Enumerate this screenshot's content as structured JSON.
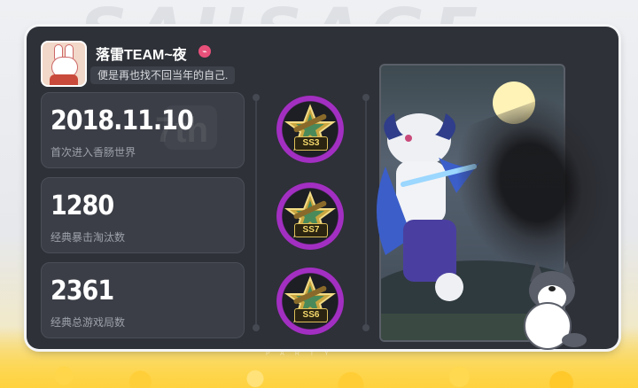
{
  "colors": {
    "panel_bg": "#2e3138",
    "card_bg": "#3b3e46",
    "badge_ring": "#a32fc2",
    "badge_gold": "#e0c05a",
    "accent_coin": "#ffd23f"
  },
  "profile": {
    "name": "落雷TEAM~夜",
    "signature": "便是再也找不回当年的自己.",
    "name_badge_icon": "ticket-icon"
  },
  "stats": [
    {
      "value": "2018.11.10",
      "label": "首次进入香肠世界"
    },
    {
      "value": "1280",
      "label": "经典暴击淘汰数"
    },
    {
      "value": "2361",
      "label": "经典总游戏局数"
    }
  ],
  "badges": [
    {
      "label": "SS3"
    },
    {
      "label": "SS7"
    },
    {
      "label": "SS6"
    }
  ],
  "decor": {
    "watermark_number": "7th"
  }
}
